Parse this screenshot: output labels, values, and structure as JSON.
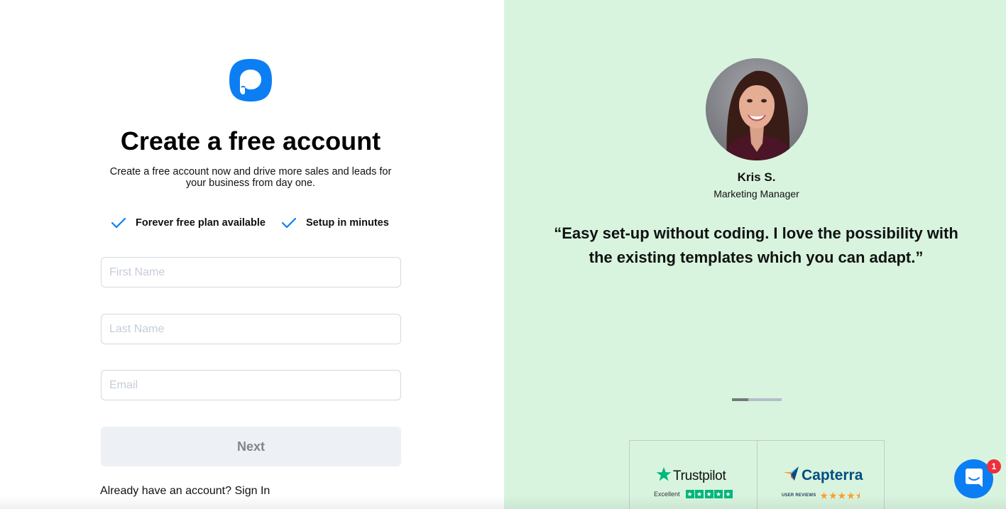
{
  "brand": {
    "logo_icon": "chat-bubble-p-logo",
    "accent_color": "#0c7ef3"
  },
  "signup": {
    "title": "Create a free account",
    "subtitle": "Create a free account now and drive more sales and leads for your business from day one.",
    "features": [
      {
        "icon": "check-icon",
        "label": "Forever free plan available"
      },
      {
        "icon": "check-icon",
        "label": "Setup in minutes"
      }
    ],
    "fields": {
      "first_name": {
        "value": "",
        "placeholder": "First Name"
      },
      "last_name": {
        "value": "",
        "placeholder": "Last Name"
      },
      "email": {
        "value": "",
        "placeholder": "Email"
      }
    },
    "next_label": "Next",
    "signin_prompt": "Already have an account?",
    "signin_link": "Sign In"
  },
  "testimonial": {
    "name": "Kris S.",
    "role": "Marketing Manager",
    "quote": "“Easy set-up without coding. I love the possibility with the existing templates which you can adapt.”",
    "carousel": {
      "current": 1,
      "total": 3
    },
    "background_color": "#d8f4df"
  },
  "reviews": {
    "trustpilot": {
      "name": "Trustpilot",
      "rating_label": "Excellent",
      "stars": 5,
      "star_color": "#00b67a"
    },
    "capterra": {
      "name": "Capterra",
      "rating_label": "USER REVIEWS",
      "stars": 4.5,
      "star_color": "#ff9d28"
    }
  },
  "chat_widget": {
    "icon": "chat-icon",
    "unread_count": "1"
  }
}
